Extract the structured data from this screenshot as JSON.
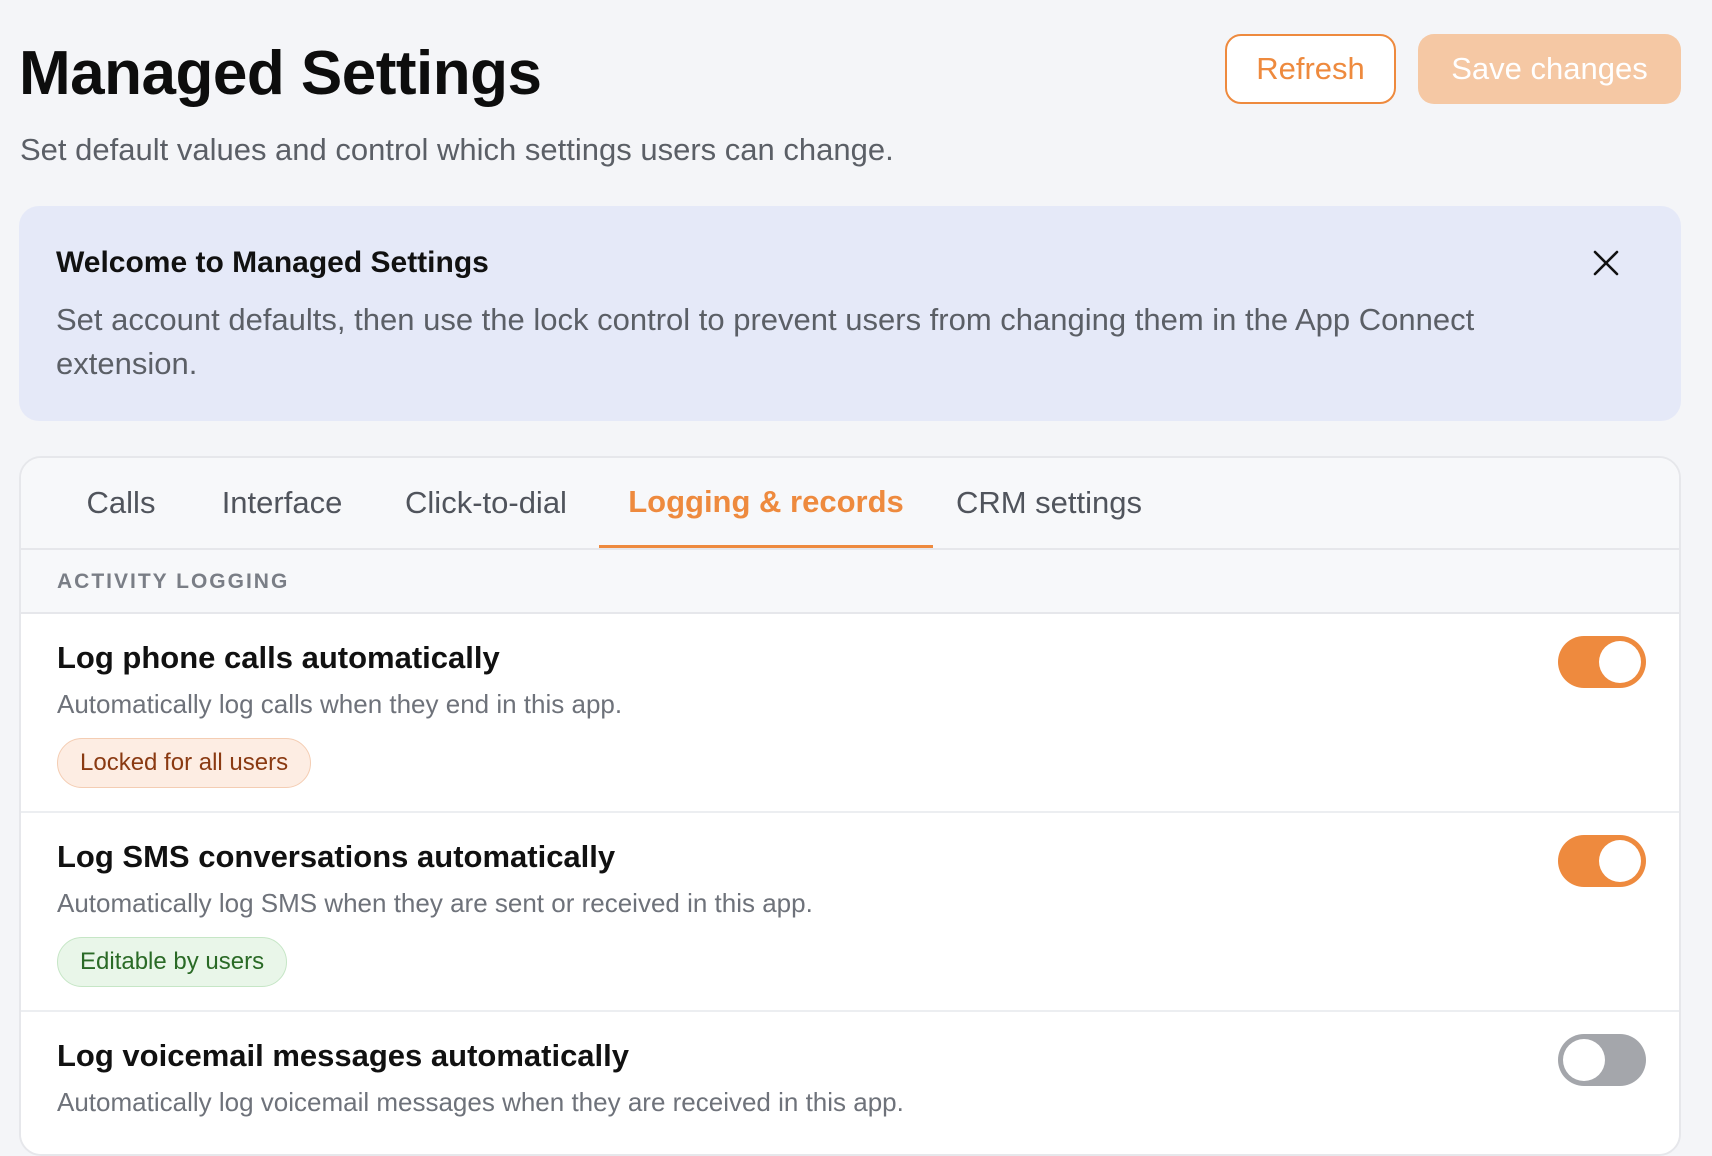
{
  "header": {
    "title": "Managed Settings",
    "subtitle": "Set default values and control which settings users can change.",
    "refresh_label": "Refresh",
    "save_label": "Save changes"
  },
  "colors": {
    "accent": "#ee8a3e",
    "accent_disabled": "#f5c8a4",
    "banner_bg": "#e5e9f8",
    "locked_badge_bg": "#fdede3",
    "editable_badge_bg": "#e9f6e9",
    "toggle_off": "#a4a6ab"
  },
  "banner": {
    "title": "Welcome to Managed Settings",
    "text": "Set account defaults, then use the lock control to prevent users from changing them in the App Connect extension.",
    "close_icon": "close-icon"
  },
  "tabs": [
    {
      "label": "Calls",
      "active": false
    },
    {
      "label": "Interface",
      "active": false
    },
    {
      "label": "Click-to-dial",
      "active": false
    },
    {
      "label": "Logging & records",
      "active": true
    },
    {
      "label": "CRM settings",
      "active": false
    }
  ],
  "section": {
    "header": "ACTIVITY LOGGING"
  },
  "settings": [
    {
      "title": "Log phone calls automatically",
      "description": "Automatically log calls when they end in this app.",
      "badge": "Locked for all users",
      "badge_type": "locked",
      "enabled": true
    },
    {
      "title": "Log SMS conversations automatically",
      "description": "Automatically log SMS when they are sent or received in this app.",
      "badge": "Editable by users",
      "badge_type": "editable",
      "enabled": true
    },
    {
      "title": "Log voicemail messages automatically",
      "description": "Automatically log voicemail messages when they are received in this app.",
      "badge": "",
      "badge_type": "",
      "enabled": false
    }
  ]
}
